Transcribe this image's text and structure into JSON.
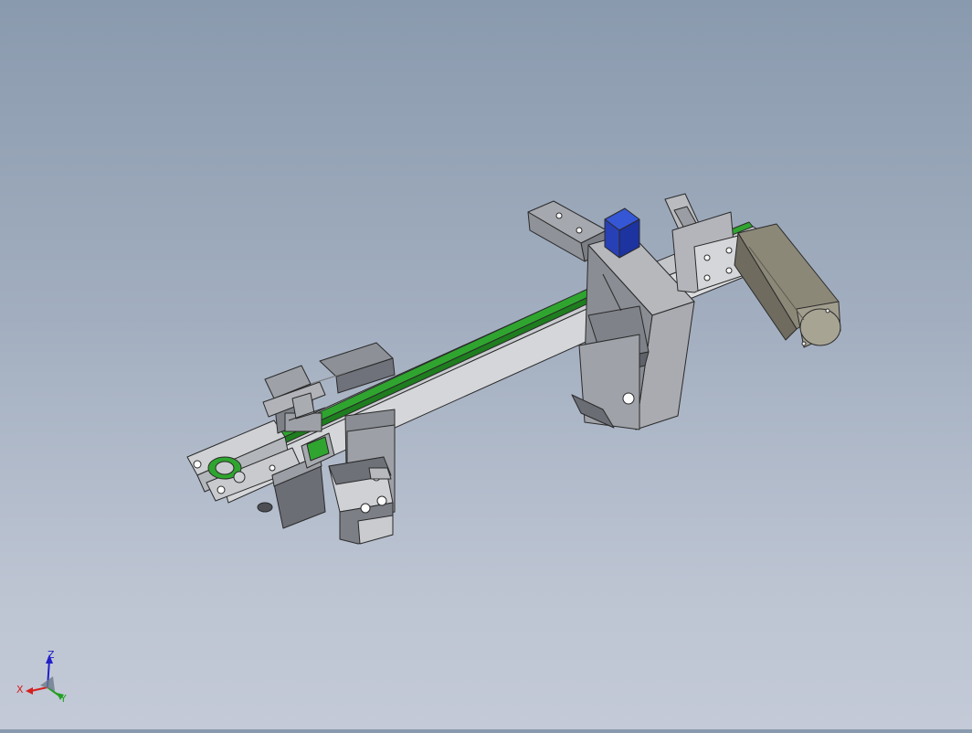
{
  "viewport": {
    "background_top": "#8a9aae",
    "background_bottom": "#c4cad7"
  },
  "model": {
    "colors": {
      "frame_gray": "#c4c6c9",
      "frame_dark": "#7d8088",
      "belt_green": "#2fa52f",
      "motor_gray": "#8c8878",
      "sensor_blue": "#2340b8",
      "outline": "#2a2a2a"
    }
  },
  "triad": {
    "x_label": "X",
    "y_label": "Y",
    "z_label": "Z",
    "x_color": "#d42020",
    "y_color": "#20a020",
    "z_color": "#2020c8"
  }
}
